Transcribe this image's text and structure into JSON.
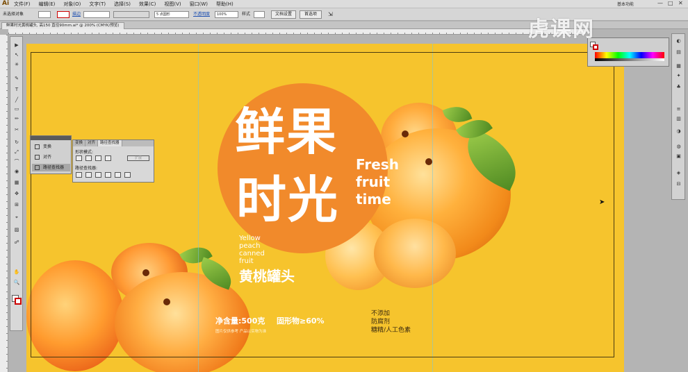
{
  "app": {
    "logo": "Ai",
    "workspace": "基本功能",
    "window_controls": [
      "—",
      "□",
      "✕"
    ]
  },
  "menu": [
    "文件(F)",
    "编辑(E)",
    "对象(O)",
    "文字(T)",
    "选择(S)",
    "效果(C)",
    "视图(V)",
    "窗口(W)",
    "帮助(H)"
  ],
  "control_bar": {
    "selection": "未选择对象",
    "stroke_label": "描边",
    "stroke_width": "",
    "brush_definition": "5 点圆形",
    "opacity_label": "不透明度",
    "opacity": "100%",
    "style_label": "样式",
    "doc_setup_button": "文档设置",
    "preferences_button": "首选项"
  },
  "document_tab": "鲜果时光黄桃罐头, 高150 直径90mm.ai* @ 200% (CMYK/预览)",
  "tools": [
    "▶",
    "↖",
    "✳",
    "✎",
    "T",
    "╱",
    "▭",
    "✏",
    "✂",
    "↻",
    "⤢",
    "⌒",
    "◉",
    "▦",
    "✥",
    "⊞",
    "⌖",
    "▨",
    "☍",
    "✋",
    "🔍"
  ],
  "panels": {
    "small": [
      "变换",
      "对齐",
      "路径查找器"
    ],
    "pathfinder": {
      "tabs": [
        "变换",
        "对齐",
        "路径查找器"
      ],
      "shape_modes_label": "形状模式:",
      "expand_button": "扩展",
      "pathfinders_label": "路径查找器:"
    }
  },
  "artwork": {
    "title_line1": "鲜果",
    "title_line2": "时光",
    "en_title": [
      "Fresh",
      "fruit",
      "time"
    ],
    "en_sub": [
      "Yellow",
      "peach",
      "canned",
      "fruit"
    ],
    "cn_sub": "黄桃罐头",
    "net_weight": "净含量:500克",
    "solids": "固形物≥60%",
    "note": "图片仅供参考 产品以实物为准",
    "no_add": [
      "不添加",
      "防腐剂",
      "糖精/人工色素"
    ]
  },
  "watermark": "虎课网",
  "colors": {
    "artboard": "#f6c42d",
    "circle": "#f18a2b"
  }
}
